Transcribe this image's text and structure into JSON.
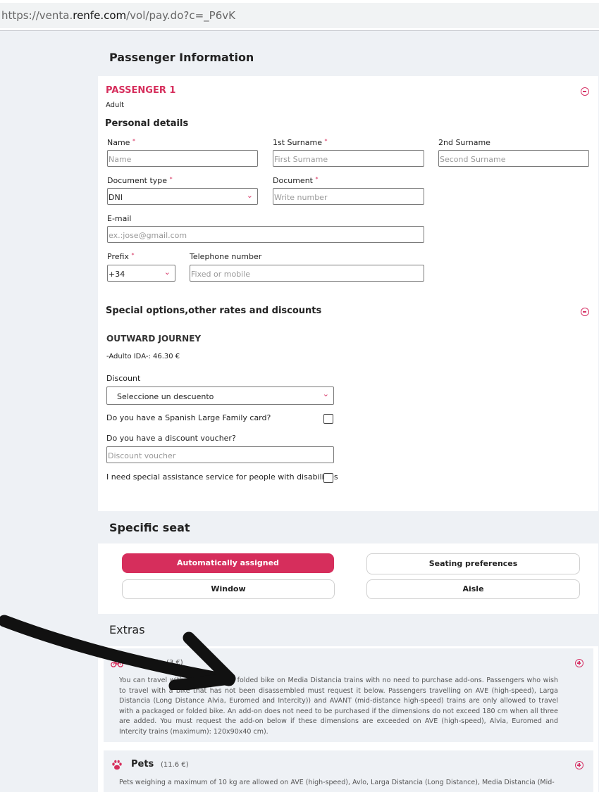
{
  "browser": {
    "url_prefix": "https://venta.",
    "url_domain": "renfe.com",
    "url_suffix": "/vol/pay.do?c=_P6vK"
  },
  "passenger_info": {
    "heading": "Passenger Information",
    "passenger_label": "PASSENGER 1",
    "passenger_type": "Adult",
    "personal_details_heading": "Personal details",
    "fields": {
      "name_label": "Name",
      "name_placeholder": "Name",
      "surname1_label": "1st Surname",
      "surname1_placeholder": "First Surname",
      "surname2_label": "2nd Surname",
      "surname2_placeholder": "Second Surname",
      "doctype_label": "Document type",
      "doctype_value": "DNI",
      "document_label": "Document",
      "document_placeholder": "Write number",
      "email_label": "E-mail",
      "email_placeholder": "ex.:jose@gmail.com",
      "prefix_label": "Prefix",
      "prefix_value": "+34",
      "phone_label": "Telephone number",
      "phone_placeholder": "Fixed or mobile",
      "required_mark": "*"
    }
  },
  "special": {
    "heading": "Special options,other rates and discounts",
    "journey_title": "OUTWARD JOURNEY",
    "fare_line": "-Adulto IDA-: 46.30 €",
    "discount_label": "Discount",
    "discount_value": "Seleccione un descuento",
    "large_family_question": "Do you have a Spanish Large Family card?",
    "voucher_question": "Do you have a discount voucher?",
    "voucher_placeholder": "Discount voucher",
    "assistance_question": "I need special assistance service for people with disabilities"
  },
  "seat": {
    "heading": "Specific seat",
    "auto_label": "Automatically assigned",
    "prefs_label": "Seating preferences",
    "window_label": "Window",
    "aisle_label": "Aisle"
  },
  "extras": {
    "heading": "Extras",
    "bikes": {
      "title": "Bikes",
      "price": "(3 €)",
      "description": "You can travel with a packaged or folded bike on Media Distancia trains with no need to purchase add-ons. Passengers who wish to travel with a bike that has not been disassembled must request it below. Passengers travelling on AVE (high-speed), Larga Distancia (Long Distance Alvia, Euromed and Intercity)) and AVANT (mid-distance high-speed) trains are only allowed to travel with a packaged or folded bike. An add-on does not need to be purchased if the dimensions do not exceed 180 cm when all three are added. You must request the add-on below if these dimensions are exceeded on AVE (high-speed), Alvia, Euromed and Intercity trains (maximum): 120x90x40 cm)."
    },
    "pets": {
      "title": "Pets",
      "price": "(11.6 €)",
      "description": "Pets weighing a maximum of 10 kg are allowed on AVE (high-speed), Avlo, Larga Distancia (Long Distance), Media Distancia (Mid-"
    }
  },
  "colors": {
    "accent": "#d62e5c",
    "page_bg": "#eef1f5"
  }
}
